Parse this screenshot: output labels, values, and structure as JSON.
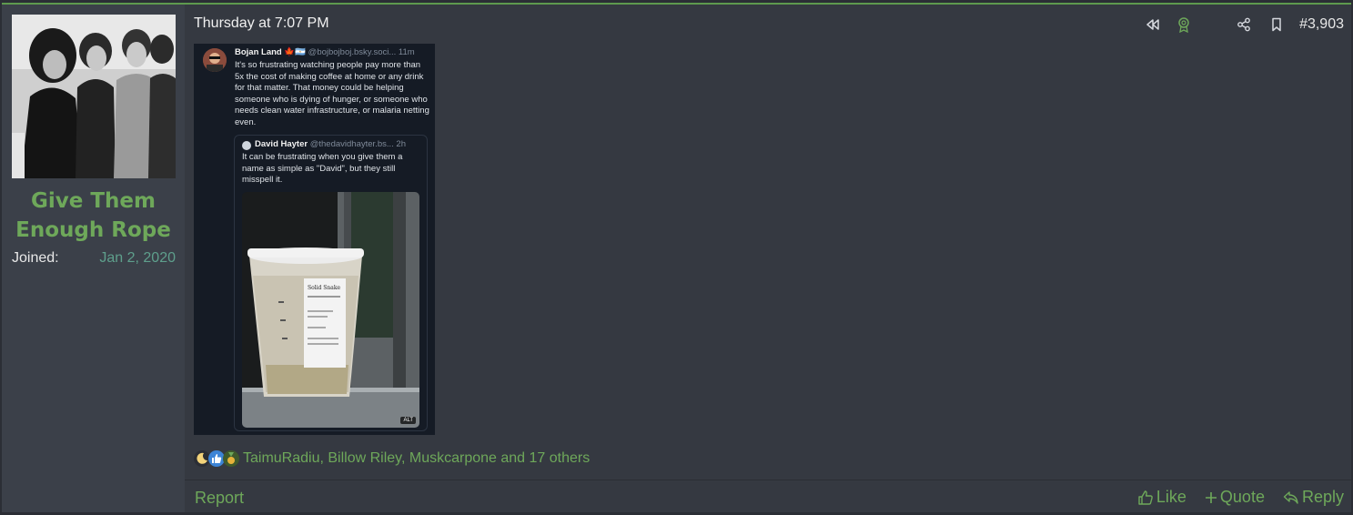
{
  "user": {
    "name": "Give Them Enough Rope",
    "joined_label": "Joined:",
    "joined_date": "Jan 2, 2020"
  },
  "post": {
    "timestamp": "Thursday at 7:07 PM",
    "number": "#3,903"
  },
  "embed": {
    "author": "Bojan Land 🍁🇦🇷",
    "handle": "@bojbojboj.bsky.soci... 11m",
    "text": "It's so frustrating watching people pay more than 5x the cost of making coffee at home or any drink for that matter. That money could be helping someone who is dying of hunger, or someone who needs clean water infrastructure, or malaria netting even.",
    "quote": {
      "author": "David Hayter",
      "handle": "@thedavidhayter.bs... 2h",
      "text": "It can be frustrating when you give them a name as simple as \"David\", but they still misspell it.",
      "cup_label": "Solid Snake",
      "alt": "ALT"
    }
  },
  "reactions": {
    "text": "TaimuRadiu, Billow Riley, Muskcarpone and 17 others",
    "icons": [
      "moon-icon",
      "thumbs-up-icon",
      "medal-icon"
    ]
  },
  "footer": {
    "report": "Report",
    "like": "Like",
    "quote": "Quote",
    "reply": "Reply"
  },
  "colors": {
    "accent": "#6ea85a",
    "background": "#353941",
    "sidebar": "#3b4049"
  }
}
